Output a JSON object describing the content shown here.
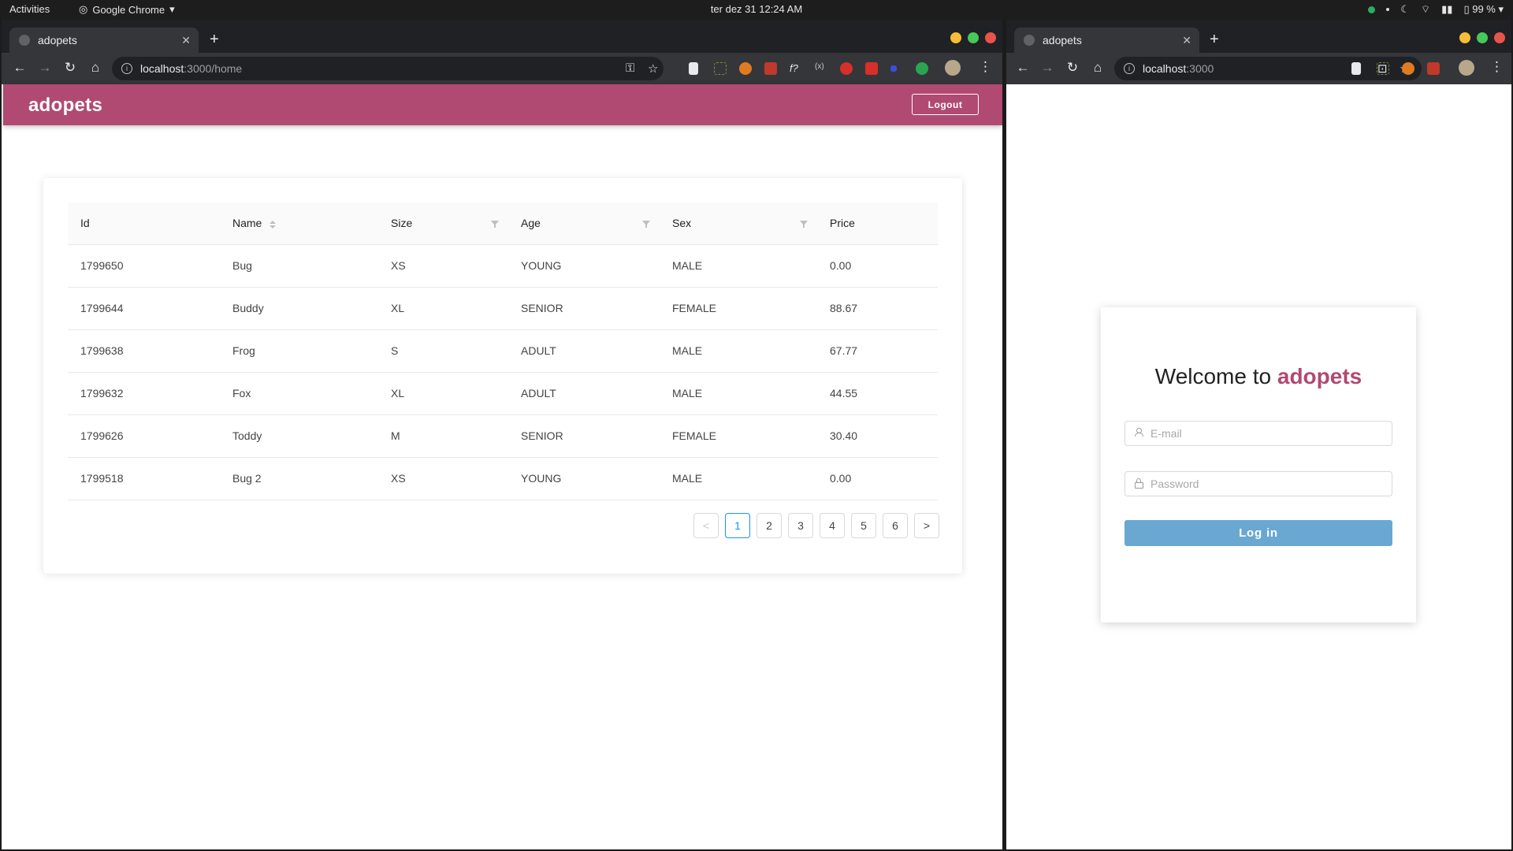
{
  "topbar": {
    "activities": "Activities",
    "app_name": "Google Chrome",
    "clock": "ter dez 31  12:24 AM",
    "battery": "99 %"
  },
  "left_window": {
    "tab_title": "adopets",
    "url_host": "localhost",
    "url_path": ":3000/home",
    "page": {
      "brand": "adopets",
      "logout_label": "Logout",
      "columns": [
        "Id",
        "Name",
        "Size",
        "Age",
        "Sex",
        "Price"
      ],
      "rows": [
        [
          "1799650",
          "Bug",
          "XS",
          "YOUNG",
          "MALE",
          "0.00"
        ],
        [
          "1799644",
          "Buddy",
          "XL",
          "SENIOR",
          "FEMALE",
          "88.67"
        ],
        [
          "1799638",
          "Frog",
          "S",
          "ADULT",
          "MALE",
          "67.77"
        ],
        [
          "1799632",
          "Fox",
          "XL",
          "ADULT",
          "MALE",
          "44.55"
        ],
        [
          "1799626",
          "Toddy",
          "M",
          "SENIOR",
          "FEMALE",
          "30.40"
        ],
        [
          "1799518",
          "Bug 2",
          "XS",
          "YOUNG",
          "MALE",
          "0.00"
        ]
      ],
      "pagination": {
        "prev": "<",
        "next": ">",
        "pages": [
          "1",
          "2",
          "3",
          "4",
          "5",
          "6"
        ],
        "current": "1"
      }
    }
  },
  "right_window": {
    "tab_title": "adopets",
    "url_host": "localhost",
    "url_path": ":3000",
    "login": {
      "title_prefix": "Welcome to",
      "title_brand": "adopets",
      "email_placeholder": "E-mail",
      "password_placeholder": "Password",
      "submit_label": "Log in"
    }
  },
  "colors": {
    "brand": "#b04a72",
    "login_button": "#6aa8d2",
    "pagination_active": "#1890ff"
  }
}
